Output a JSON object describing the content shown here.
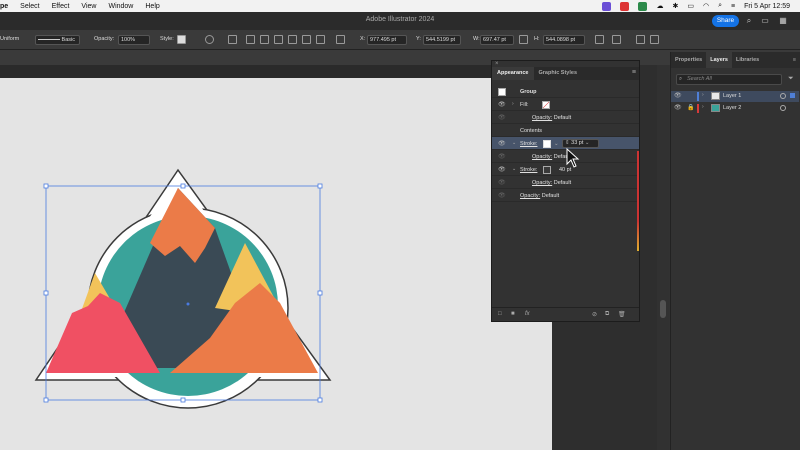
{
  "menubar": {
    "items": [
      "pe",
      "Select",
      "Effect",
      "View",
      "Window",
      "Help"
    ],
    "clock": "Fri 5 Apr  12:59"
  },
  "titlebar": {
    "title": "Adobe Illustrator 2024",
    "share_label": "Share"
  },
  "controlbar": {
    "stroke_profile": "Uniform",
    "brush": "Basic",
    "opacity_label": "Opacity:",
    "opacity_value": "100%",
    "style_label": "Style:",
    "x_label": "X:",
    "x_value": "977.495 pt",
    "y_label": "Y:",
    "y_value": "544.5199 pt",
    "w_label": "W:",
    "w_value": "697.47 pt",
    "h_label": "H:",
    "h_value": "544.0898 pt"
  },
  "appearance": {
    "tabs": [
      "Appearance",
      "Graphic Styles"
    ],
    "group_label": "Group",
    "rows": [
      {
        "kind": "fill",
        "label": "Fill:"
      },
      {
        "kind": "opacity",
        "label": "Opacity:",
        "value": "Default"
      },
      {
        "kind": "contents",
        "label": "Contents"
      },
      {
        "kind": "stroke",
        "label": "Stroke:",
        "value": "33 pt"
      },
      {
        "kind": "opacity",
        "label": "Opacity:",
        "value": "Default"
      },
      {
        "kind": "stroke",
        "label": "Stroke:",
        "value": "40 pt"
      },
      {
        "kind": "opacity",
        "label": "Opacity:",
        "value": "Default"
      },
      {
        "kind": "opacity",
        "label": "Opacity:",
        "value": "Default"
      }
    ]
  },
  "layers_panel": {
    "tabs": [
      "Properties",
      "Layers",
      "Libraries"
    ],
    "active_tab": "Layers",
    "search_placeholder": "Search All",
    "layers": [
      {
        "name": "Layer 1",
        "color": "#4f7fd6"
      },
      {
        "name": "Layer 2",
        "color": "#d63a3a"
      }
    ]
  },
  "colors": {
    "teal": "#3aa39a",
    "navy": "#3a4a55",
    "orange": "#eb7b48",
    "yellow": "#f2c35a",
    "coral": "#f05063",
    "selection": "#4a7be0",
    "share_blue": "#1473e6"
  }
}
